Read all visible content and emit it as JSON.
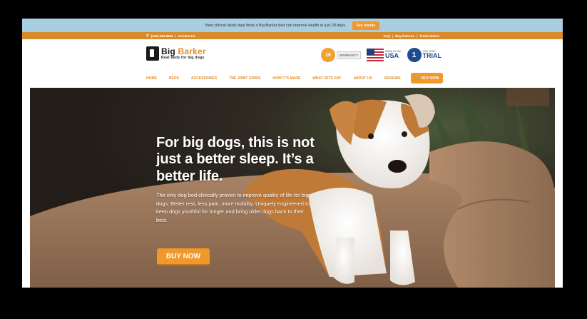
{
  "announcement": {
    "text": "New clinical study data finds a Big Barker bed can improve health in just 28 days.",
    "button_label": "See results"
  },
  "utility": {
    "phone": "(215) 840-5984",
    "contact": "Contact Us",
    "links": [
      "FAQ",
      "Buy Returns",
      "Track Orders"
    ]
  },
  "logo": {
    "name_part1": "Big",
    "name_part2": "Barker",
    "tagline": "Real beds for big dogs"
  },
  "badges": {
    "warranty_number": "10",
    "warranty_label": "WARRANTY",
    "usa_small": "MADE IN THE",
    "usa_big": "USA",
    "trial_number": "1",
    "trial_small": "ONE YEAR",
    "trial_big": "TRIAL"
  },
  "nav": {
    "items": [
      "HOME",
      "BEDS",
      "ACCESSORIES",
      "THE JOINT CRISIS",
      "HOW IT'S MADE",
      "WHAT VETS SAY",
      "ABOUT US",
      "REVIEWS"
    ],
    "buy_label": "BUY NOW"
  },
  "hero": {
    "title": "For big dogs, this is not just a better sleep. It’s a better life.",
    "body": "The only dog bed clinically proven to improve quality of life for big dogs. Better rest, less pain, more mobility. Uniquely engineered to keep dogs youthful for longer and bring older dogs back to their best.",
    "button_label": "BUY NOW"
  },
  "colors": {
    "accent": "#f0982a",
    "utility_bar": "#d98a2c",
    "announcement_bar": "#a9cde1",
    "brand_blue": "#1f4a8f"
  }
}
